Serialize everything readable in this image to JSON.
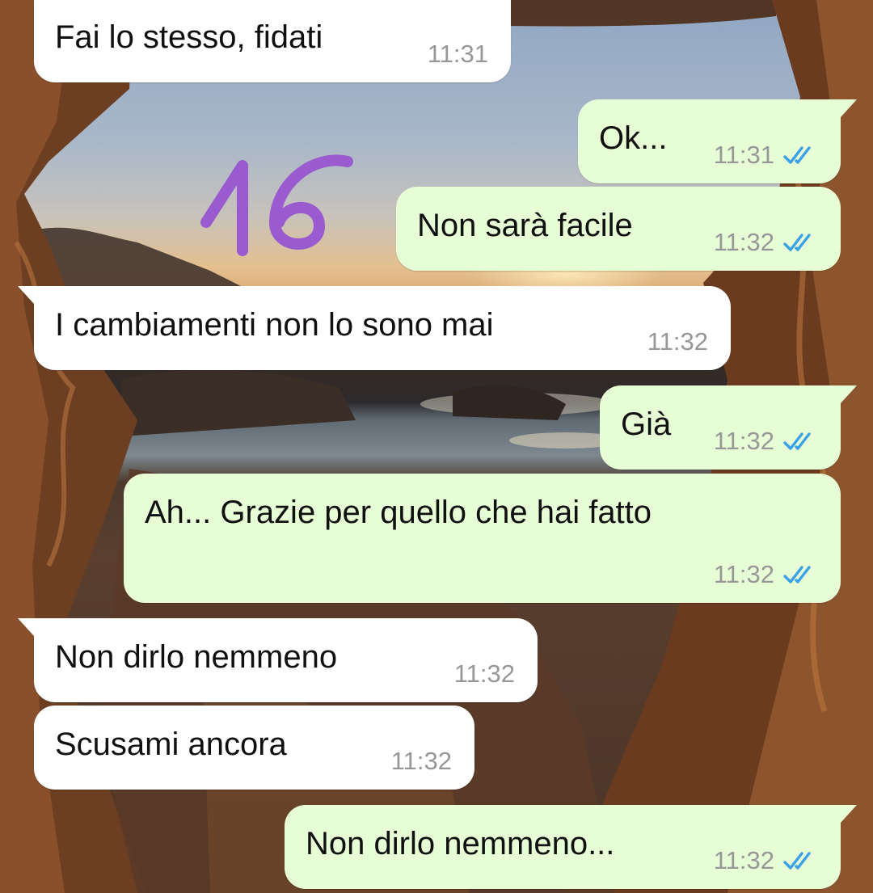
{
  "colors": {
    "incoming_bubble": "#ffffff",
    "outgoing_bubble": "#e7fdd5",
    "read_ticks": "#3aa1e8",
    "timestamp": "#979797",
    "overlay_number": "#9a5bd0"
  },
  "overlay": {
    "handwritten_number": "16"
  },
  "messages": [
    {
      "direction": "incoming",
      "text": "Fai lo stesso, fidati",
      "time": "11:31"
    },
    {
      "direction": "outgoing",
      "text": "Ok...",
      "time": "11:31",
      "status_icon": "double-check-read-icon"
    },
    {
      "direction": "outgoing",
      "text": "Non sarà facile",
      "time": "11:32",
      "status_icon": "double-check-read-icon"
    },
    {
      "direction": "incoming",
      "text": "I cambiamenti non lo sono mai",
      "time": "11:32"
    },
    {
      "direction": "outgoing",
      "text": "Già",
      "time": "11:32",
      "status_icon": "double-check-read-icon"
    },
    {
      "direction": "outgoing",
      "text": "Ah... Grazie per quello che hai fatto",
      "time": "11:32",
      "status_icon": "double-check-read-icon"
    },
    {
      "direction": "incoming",
      "text": "Non dirlo nemmeno",
      "time": "11:32"
    },
    {
      "direction": "incoming",
      "text": "Scusami ancora",
      "time": "11:32"
    },
    {
      "direction": "outgoing",
      "text": "Non dirlo nemmeno...",
      "time": "11:32",
      "status_icon": "double-check-read-icon"
    }
  ]
}
